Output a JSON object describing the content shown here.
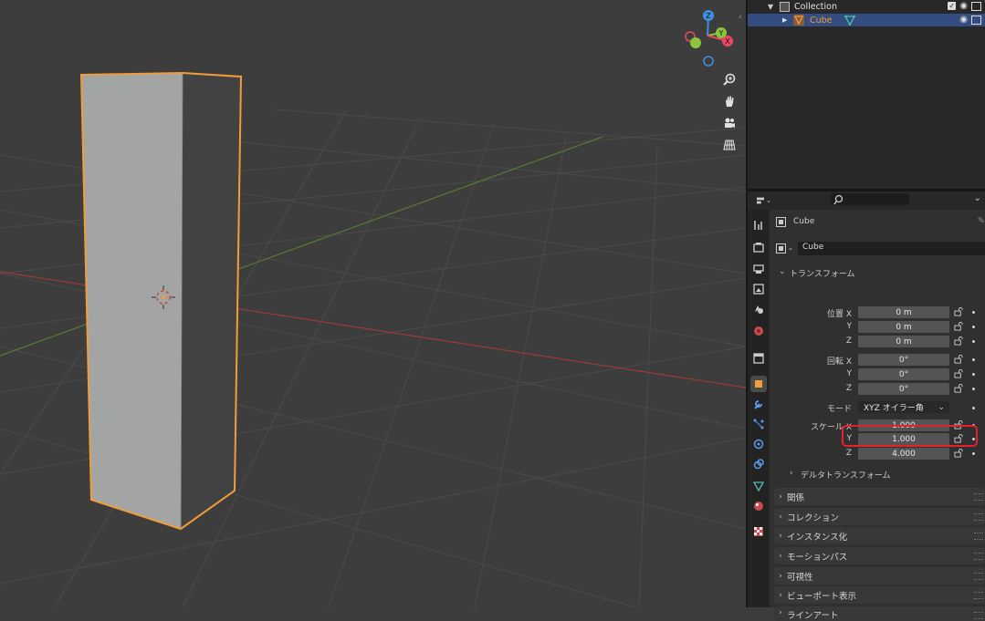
{
  "outliner": {
    "rows": [
      {
        "label": "Collection",
        "icon": "collection-icon"
      },
      {
        "label": "Cube",
        "icon": "mesh-object-icon"
      }
    ]
  },
  "properties": {
    "object_name": "Cube",
    "datablock_name": "Cube",
    "transform_header": "トランスフォーム",
    "location": {
      "label_x": "位置 X",
      "label_y": "Y",
      "label_z": "Z",
      "x": "0 m",
      "y": "0 m",
      "z": "0 m"
    },
    "rotation": {
      "label_x": "回転 X",
      "label_y": "Y",
      "label_z": "Z",
      "x": "0°",
      "y": "0°",
      "z": "0°"
    },
    "mode": {
      "label": "モード",
      "value": "XYZ オイラー角"
    },
    "scale": {
      "label_x": "スケール X",
      "label_y": "Y",
      "label_z": "Z",
      "x": "1.000",
      "y": "1.000",
      "z": "4.000"
    },
    "delta_transform": "デルタトランスフォーム",
    "panels": [
      "関係",
      "コレクション",
      "インスタンス化",
      "モーションパス",
      "可視性",
      "ビューポート表示",
      "ラインアート"
    ]
  },
  "gizmo": {
    "x": "X",
    "y": "Y",
    "z": "Z"
  },
  "colors": {
    "accent_orange": "#f39c3a",
    "selected_row": "#334d80",
    "highlight_red": "#e6202c",
    "axis_x": "#e84a5f",
    "axis_y": "#8cc63f",
    "axis_z": "#3d8fe0"
  }
}
